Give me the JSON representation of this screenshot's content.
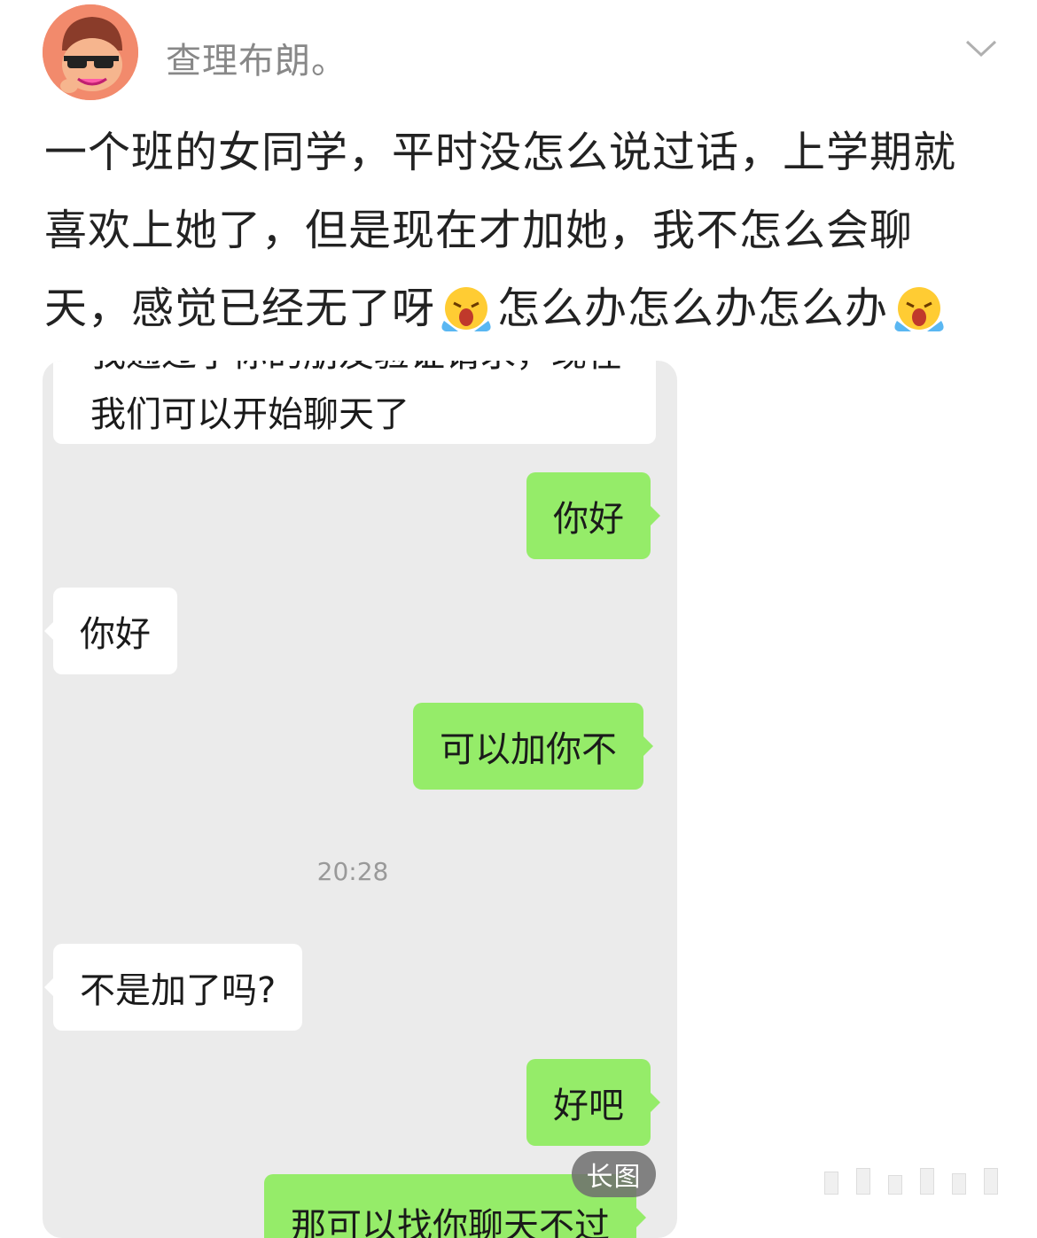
{
  "post": {
    "username": "查理布朗。",
    "text_lines": [
      "一个班的女同学，平时没怎么说过话，上学期就",
      "喜欢上她了，但是现在才加她，我不怎么会聊",
      "天，感觉已经无了呀",
      "怎么办怎么办怎么办"
    ]
  },
  "chat": {
    "system_cut_line": "我通过了你的朋友验证请求，现在",
    "system_line": "我们可以开始聊天了",
    "messages": [
      {
        "side": "right",
        "text": "你好"
      },
      {
        "side": "left",
        "text": "你好"
      },
      {
        "side": "right",
        "text": "可以加你不"
      },
      {
        "side": "left",
        "text": "不是加了吗?"
      },
      {
        "side": "right",
        "text": "好吧"
      },
      {
        "side": "right",
        "text": "那可以找你聊天不过"
      }
    ],
    "timestamp": "20:28"
  },
  "badge": {
    "label": "长图"
  },
  "icons": {
    "avatar": "cartoon-avatar-icon",
    "chevron": "chevron-down-icon",
    "emoji": "loudly-crying-face-icon"
  },
  "colors": {
    "my_bubble": "#95ec69",
    "their_bubble": "#ffffff",
    "chat_bg": "#ebebeb"
  }
}
